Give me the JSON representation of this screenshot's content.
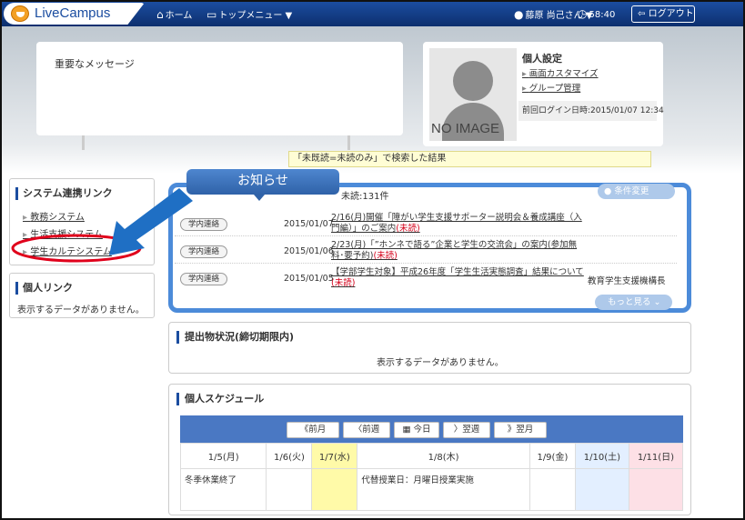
{
  "header": {
    "app_name": "LiveCampus",
    "home": "ホーム",
    "top_menu": "トップメニュー",
    "user": "藤原 尚己さん",
    "timer": "58:40",
    "logout": "ログアウト"
  },
  "important": {
    "title": "重要なメッセージ"
  },
  "profile": {
    "no_image": "NO IMAGE",
    "settings_title": "個人設定",
    "links": [
      "画面カスタマイズ",
      "グループ管理"
    ],
    "last_login": "前回ログイン日時:2015/01/07 12:34"
  },
  "search_result": "「未既読=未読のみ」で検索した結果",
  "system_links": {
    "title": "システム連携リンク",
    "items": [
      "教務システム",
      "生活支援システム",
      "学生カルテシステム"
    ]
  },
  "personal_links": {
    "title": "個人リンク",
    "empty": "表示するデータがありません。"
  },
  "notices": {
    "tab": "お知らせ",
    "unread_count": "未読:131件",
    "condition_button": "条件変更",
    "more_button": "もっと見る",
    "items": [
      {
        "tag": "学内連絡",
        "date": "2015/01/07",
        "title": "2/16(月)開催「障がい学生支援サポーター説明会＆養成講座（入門編）」のご案内",
        "status": "(未読)",
        "org": ""
      },
      {
        "tag": "学内連絡",
        "date": "2015/01/06",
        "title": "2/23(月)「”ホンネで語る”企業と学生の交流会」の案内(参加無料･要予約)",
        "status": "(未読)",
        "org": ""
      },
      {
        "tag": "学内連絡",
        "date": "2015/01/05",
        "title": "【学部学生対象】平成26年度「学生生活実態調査」結果について",
        "status": "(未読)",
        "org": "教育学生支援機構長"
      }
    ]
  },
  "submissions": {
    "title": "提出物状況(締切期限内)",
    "empty": "表示するデータがありません。"
  },
  "schedule": {
    "title": "個人スケジュール",
    "nav": [
      "前月",
      "前週",
      "今日",
      "翌週",
      "翌月"
    ],
    "days": [
      "1/5(月)",
      "1/6(火)",
      "1/7(水)",
      "1/8(木)",
      "1/9(金)",
      "1/10(土)",
      "1/11(日)"
    ],
    "events": [
      "冬季休業終了",
      "",
      "",
      "代替授業日：月曜日授業実施",
      "",
      "",
      ""
    ]
  }
}
